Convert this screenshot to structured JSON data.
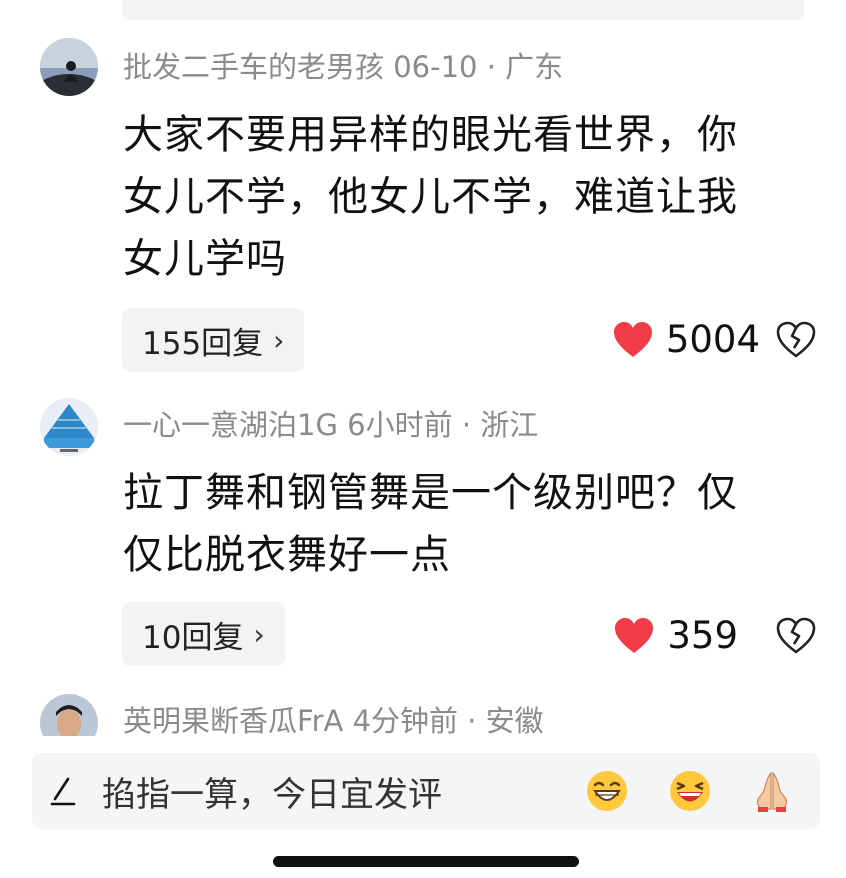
{
  "comments": [
    {
      "username": "批发二手车的老男孩",
      "time": "06-10",
      "location": "广东",
      "text_lines": [
        "大家不要用异样的眼光看世界，你",
        "女儿不学，他女儿不学，难道让我",
        "女儿学吗"
      ],
      "reply_label": "155回复",
      "likes": "5004"
    },
    {
      "username": "一心一意湖泊1G",
      "time": "6小时前",
      "location": "浙江",
      "text_lines": [
        "拉丁舞和钢管舞是一个级别吧？仅",
        "仅比脱衣舞好一点"
      ],
      "reply_label": "10回复",
      "likes": "359"
    },
    {
      "username": "英明果断香瓜FrA",
      "time": "4分钟前",
      "location": "安徽"
    }
  ],
  "comment_bar": {
    "placeholder": "掐指一算，今日宜发评",
    "emojis": [
      "grinning-face-emoji",
      "laughing-face-emoji",
      "folded-hands-emoji"
    ]
  },
  "colors": {
    "like_red": "#f03c46",
    "meta_gray": "#8a8a8f",
    "bar_bg": "#f4f5f7"
  }
}
